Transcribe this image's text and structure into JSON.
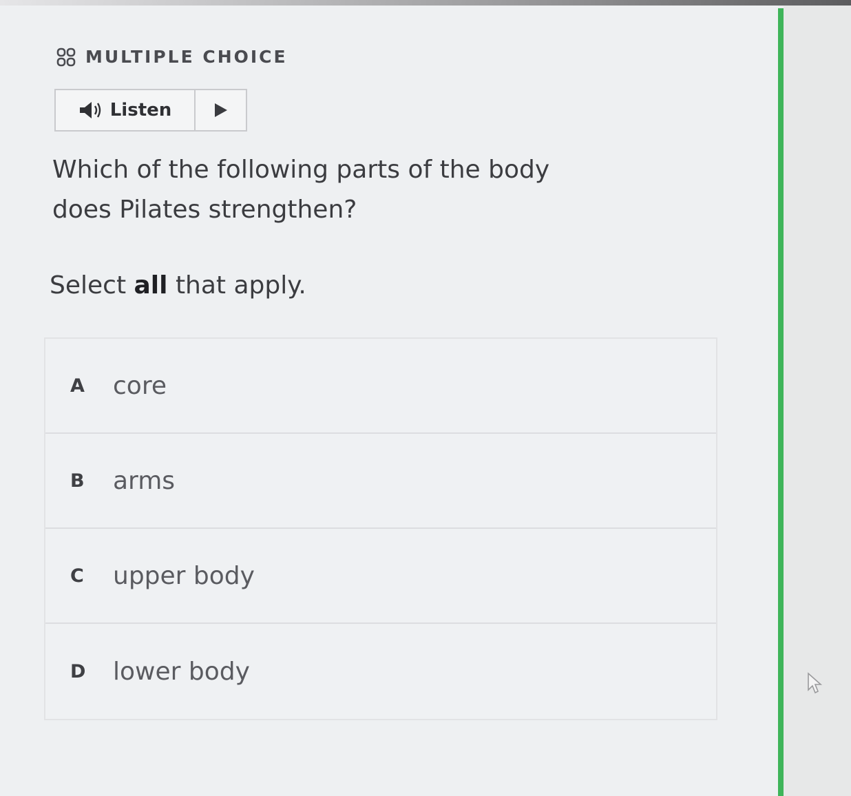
{
  "header": {
    "icon": "grid-icon",
    "label": "MULTIPLE CHOICE"
  },
  "listen": {
    "icon": "speaker-icon",
    "label": "Listen",
    "play_icon": "play-icon"
  },
  "question": {
    "text": "Which of the following parts of the body does Pilates strengthen?"
  },
  "instruction": {
    "prefix": "Select ",
    "emphasis": "all",
    "suffix": " that apply."
  },
  "options": [
    {
      "letter": "A",
      "text": "core"
    },
    {
      "letter": "B",
      "text": "arms"
    },
    {
      "letter": "C",
      "text": "upper body"
    },
    {
      "letter": "D",
      "text": "lower body"
    }
  ],
  "colors": {
    "accent_bar": "#3fb55a",
    "panel_background": "#eef0f2",
    "border": "#c9cacd"
  }
}
